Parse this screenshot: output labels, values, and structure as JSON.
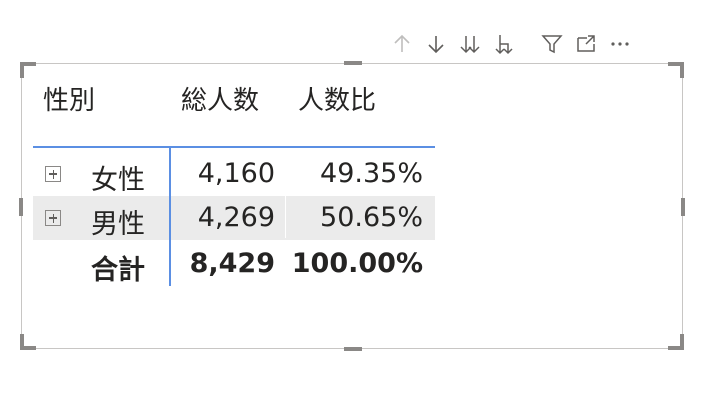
{
  "toolbar": {
    "items": [
      {
        "name": "drill-up",
        "icon": "arrow-up-icon",
        "disabled": true
      },
      {
        "name": "drill-down",
        "icon": "arrow-down-icon"
      },
      {
        "name": "next-level",
        "icon": "double-arrow-down-icon"
      },
      {
        "name": "expand-all",
        "icon": "fork-down-icon"
      },
      {
        "name": "filter",
        "icon": "filter-icon"
      },
      {
        "name": "focus-mode",
        "icon": "focus-mode-icon"
      },
      {
        "name": "more-options",
        "icon": "more-icon"
      }
    ]
  },
  "matrix": {
    "headers": {
      "group": "性別",
      "count": "総人数",
      "ratio": "人数比"
    },
    "rows": [
      {
        "label": "女性",
        "count": "4,160",
        "ratio": "49.35%"
      },
      {
        "label": "男性",
        "count": "4,269",
        "ratio": "50.65%"
      }
    ],
    "total": {
      "label": "合計",
      "count": "8,429",
      "ratio": "100.00%"
    }
  },
  "colors": {
    "accent": "#5b8fe3",
    "alt_row": "#ebebeb",
    "border": "#c8c6c4",
    "text": "#252423"
  }
}
